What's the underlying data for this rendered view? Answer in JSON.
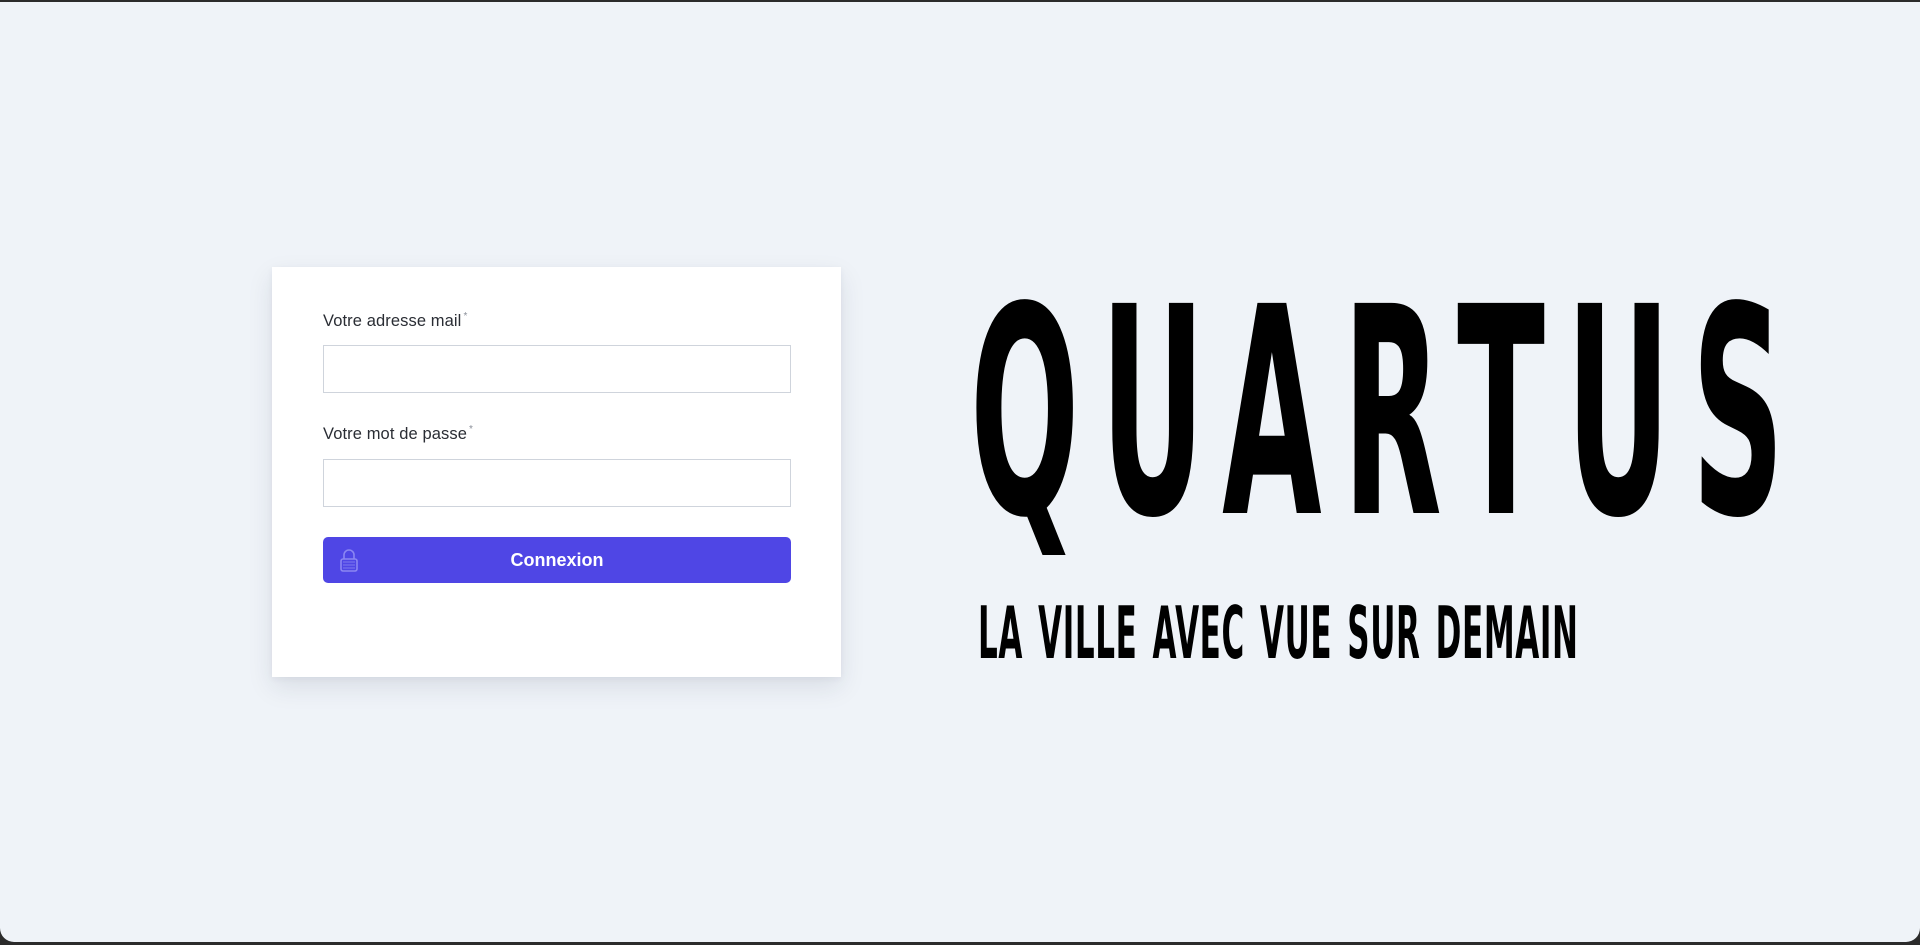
{
  "login_form": {
    "email_label": "Votre adresse mail",
    "email_required_mark": "*",
    "email_value": "",
    "email_placeholder": "",
    "password_label": "Votre mot de passe",
    "password_required_mark": "*",
    "password_value": "",
    "password_placeholder": "",
    "submit_label": "Connexion",
    "submit_icon": "lock-icon"
  },
  "brand": {
    "title": "QUARTUS",
    "tagline": "LA VILLE AVEC VUE SUR DEMAIN"
  },
  "colors": {
    "background": "#eff3f8",
    "card": "#ffffff",
    "accent": "#4f46e5",
    "brand_text": "#000000"
  }
}
